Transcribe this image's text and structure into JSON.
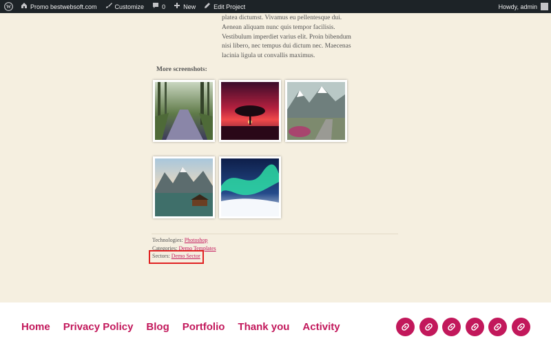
{
  "adminbar": {
    "site_name": "Promo bestwebsoft.com",
    "customize": "Customize",
    "comments_count": "0",
    "new_label": "New",
    "edit_label": "Edit Project",
    "howdy": "Howdy, admin"
  },
  "article": {
    "lines": [
      "platea dictumst. Vivamus eu pellentesque dui.",
      "Aenean aliquam nunc quis tempor facilisis.",
      "Vestibulum imperdiet varius elit. Proin bibendum",
      "nisi libero, nec tempus dui dictum nec. Maecenas",
      "lacinia ligula ut convallis maximus."
    ]
  },
  "screenshots": {
    "title": "More screenshots:"
  },
  "meta": {
    "technologies_label": "Technologies:",
    "technologies_value": "Photoshop",
    "categories_label": "Categories:",
    "categories_value": "Demo Templates",
    "sectors_label": "Sectors:",
    "sectors_value": "Demo Sector"
  },
  "footer": {
    "nav": [
      "Home",
      "Privacy Policy",
      "Blog",
      "Portfolio",
      "Thank you",
      "Activity"
    ]
  },
  "colors": {
    "accent": "#c2185b",
    "adminbar_bg": "#1d2327",
    "page_bg": "#f5efe0",
    "highlight": "#e02020"
  }
}
